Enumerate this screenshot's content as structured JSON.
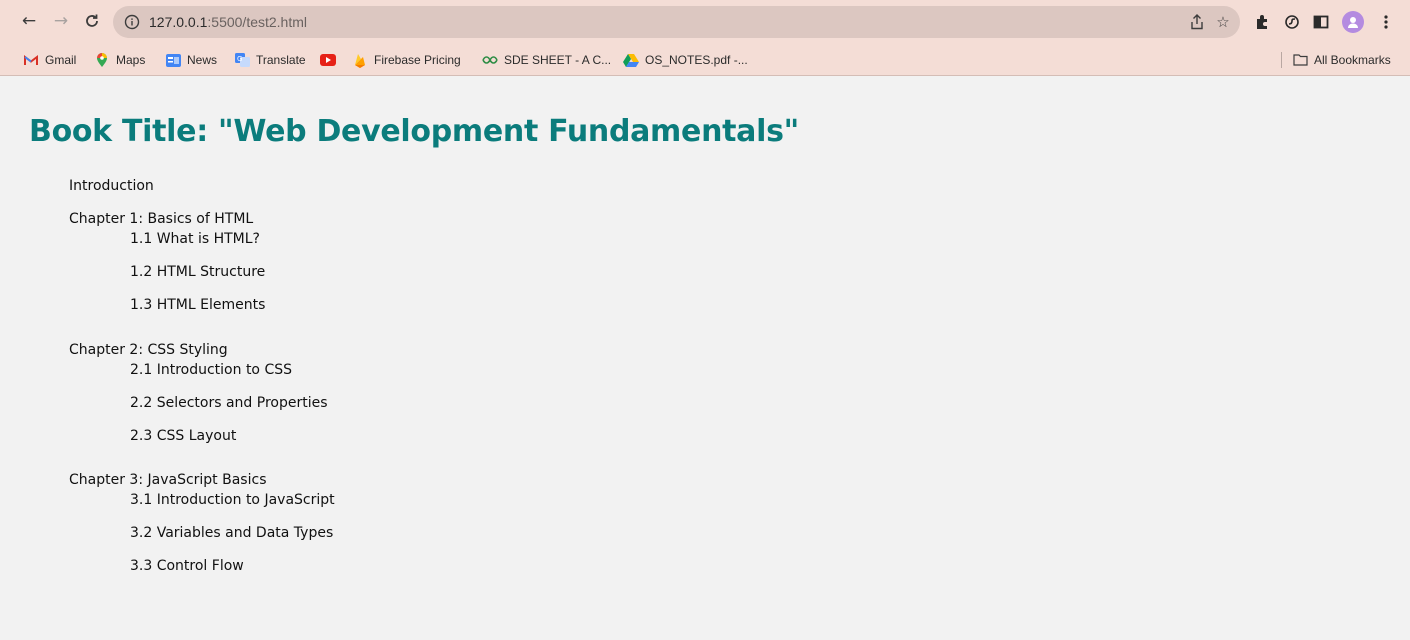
{
  "browser": {
    "url_host": "127.0.0.1",
    "url_rest": ":5500/test2.html",
    "bookmarks": [
      {
        "label": "Gmail",
        "icon": "gmail-icon"
      },
      {
        "label": "Maps",
        "icon": "maps-icon"
      },
      {
        "label": "News",
        "icon": "news-icon"
      },
      {
        "label": "Translate",
        "icon": "translate-icon"
      },
      {
        "label": "",
        "icon": "youtube-icon"
      },
      {
        "label": "Firebase Pricing",
        "icon": "firebase-icon"
      },
      {
        "label": "SDE SHEET - A C...",
        "icon": "sde-sheet-icon"
      },
      {
        "label": "OS_NOTES.pdf -...",
        "icon": "drive-icon"
      }
    ],
    "all_bookmarks": "All Bookmarks"
  },
  "page": {
    "title": "Book Title: \"Web Development Fundamentals\"",
    "intro": "Introduction",
    "chapters": [
      {
        "title": "Chapter 1: Basics of HTML",
        "sections": [
          "1.1 What is HTML?",
          "1.2 HTML Structure",
          "1.3 HTML Elements"
        ]
      },
      {
        "title": "Chapter 2: CSS Styling",
        "sections": [
          "2.1 Introduction to CSS",
          "2.2 Selectors and Properties",
          "2.3 CSS Layout"
        ]
      },
      {
        "title": "Chapter 3: JavaScript Basics",
        "sections": [
          "3.1 Introduction to JavaScript",
          "3.2 Variables and Data Types",
          "3.3 Control Flow"
        ]
      }
    ]
  },
  "colors": {
    "title": "#0b7c7c",
    "chrome": "#f4ddd6",
    "omnibox": "#dcc7c1",
    "page_bg": "#f2f2f2"
  }
}
